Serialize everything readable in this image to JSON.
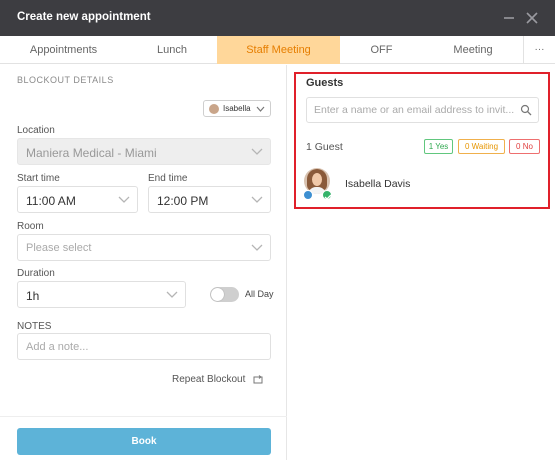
{
  "window": {
    "title": "Create new appointment"
  },
  "tabs": [
    {
      "label": "Appointments",
      "active": false
    },
    {
      "label": "Lunch",
      "active": false
    },
    {
      "label": "Staff Meeting",
      "active": true
    },
    {
      "label": "OFF",
      "active": false
    },
    {
      "label": "Meeting",
      "active": false
    }
  ],
  "tabs_more": "···",
  "form": {
    "section_title": "BLOCKOUT DETAILS",
    "owner": "Isabella",
    "location_label": "Location",
    "location_value": "Maniera Medical - Miami",
    "start_label": "Start time",
    "start_value": "11:00 AM",
    "end_label": "End time",
    "end_value": "12:00 PM",
    "room_label": "Room",
    "room_placeholder": "Please select",
    "duration_label": "Duration",
    "duration_value": "1h",
    "allday_label": "All Day",
    "allday_on": false,
    "notes_label": "NOTES",
    "notes_placeholder": "Add a note...",
    "repeat_label": "Repeat Blockout",
    "book_label": "Book"
  },
  "guests": {
    "title": "Guests",
    "search_placeholder": "Enter a name or an email address to invit...",
    "count_label": "1 Guest",
    "yes_label": "1 Yes",
    "waiting_label": "0 Waiting",
    "no_label": "0 No",
    "list": [
      {
        "name": "Isabella Davis"
      }
    ]
  },
  "colors": {
    "titlebar": "#3d3d41",
    "active_tab_bg": "#ffd79a",
    "active_tab_text": "#e67e00",
    "book_button": "#5db3d8",
    "highlight_border": "#e0202a"
  }
}
